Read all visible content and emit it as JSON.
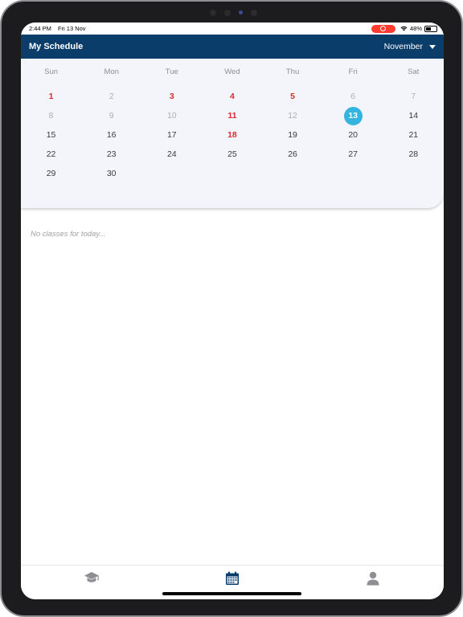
{
  "status": {
    "time": "2:44 PM",
    "date": "Fri 13 Nov",
    "battery": "48%"
  },
  "header": {
    "title": "My Schedule",
    "month": "November"
  },
  "calendar": {
    "weekdays": [
      "Sun",
      "Mon",
      "Tue",
      "Wed",
      "Thu",
      "Fri",
      "Sat"
    ],
    "weeks": [
      [
        {
          "d": "1",
          "s": "red"
        },
        {
          "d": "2",
          "s": "muted"
        },
        {
          "d": "3",
          "s": "red"
        },
        {
          "d": "4",
          "s": "red"
        },
        {
          "d": "5",
          "s": "red"
        },
        {
          "d": "6",
          "s": "muted"
        },
        {
          "d": "7",
          "s": "muted"
        }
      ],
      [
        {
          "d": "8",
          "s": "muted"
        },
        {
          "d": "9",
          "s": "muted"
        },
        {
          "d": "10",
          "s": "muted"
        },
        {
          "d": "11",
          "s": "red"
        },
        {
          "d": "12",
          "s": "muted"
        },
        {
          "d": "13",
          "s": "today"
        },
        {
          "d": "14",
          "s": "normal"
        }
      ],
      [
        {
          "d": "15",
          "s": "normal"
        },
        {
          "d": "16",
          "s": "normal"
        },
        {
          "d": "17",
          "s": "normal"
        },
        {
          "d": "18",
          "s": "red"
        },
        {
          "d": "19",
          "s": "normal"
        },
        {
          "d": "20",
          "s": "normal"
        },
        {
          "d": "21",
          "s": "normal"
        }
      ],
      [
        {
          "d": "22",
          "s": "normal"
        },
        {
          "d": "23",
          "s": "normal"
        },
        {
          "d": "24",
          "s": "normal"
        },
        {
          "d": "25",
          "s": "normal"
        },
        {
          "d": "26",
          "s": "normal"
        },
        {
          "d": "27",
          "s": "normal"
        },
        {
          "d": "28",
          "s": "normal"
        }
      ],
      [
        {
          "d": "29",
          "s": "normal"
        },
        {
          "d": "30",
          "s": "normal"
        },
        {
          "d": "",
          "s": "normal"
        },
        {
          "d": "",
          "s": "normal"
        },
        {
          "d": "",
          "s": "normal"
        },
        {
          "d": "",
          "s": "normal"
        },
        {
          "d": "",
          "s": "normal"
        }
      ]
    ]
  },
  "main": {
    "empty_message": "No classes for today..."
  },
  "tabs": [
    {
      "icon": "graduation-cap-icon",
      "active": false
    },
    {
      "icon": "calendar-icon",
      "active": true
    },
    {
      "icon": "user-icon",
      "active": false
    }
  ],
  "colors": {
    "appbar": "#0b3d6b",
    "today": "#35b4e0",
    "holiday_red": "#d92b2b",
    "tab_active": "#0b3d6b",
    "tab_inactive": "#8e8e93"
  }
}
